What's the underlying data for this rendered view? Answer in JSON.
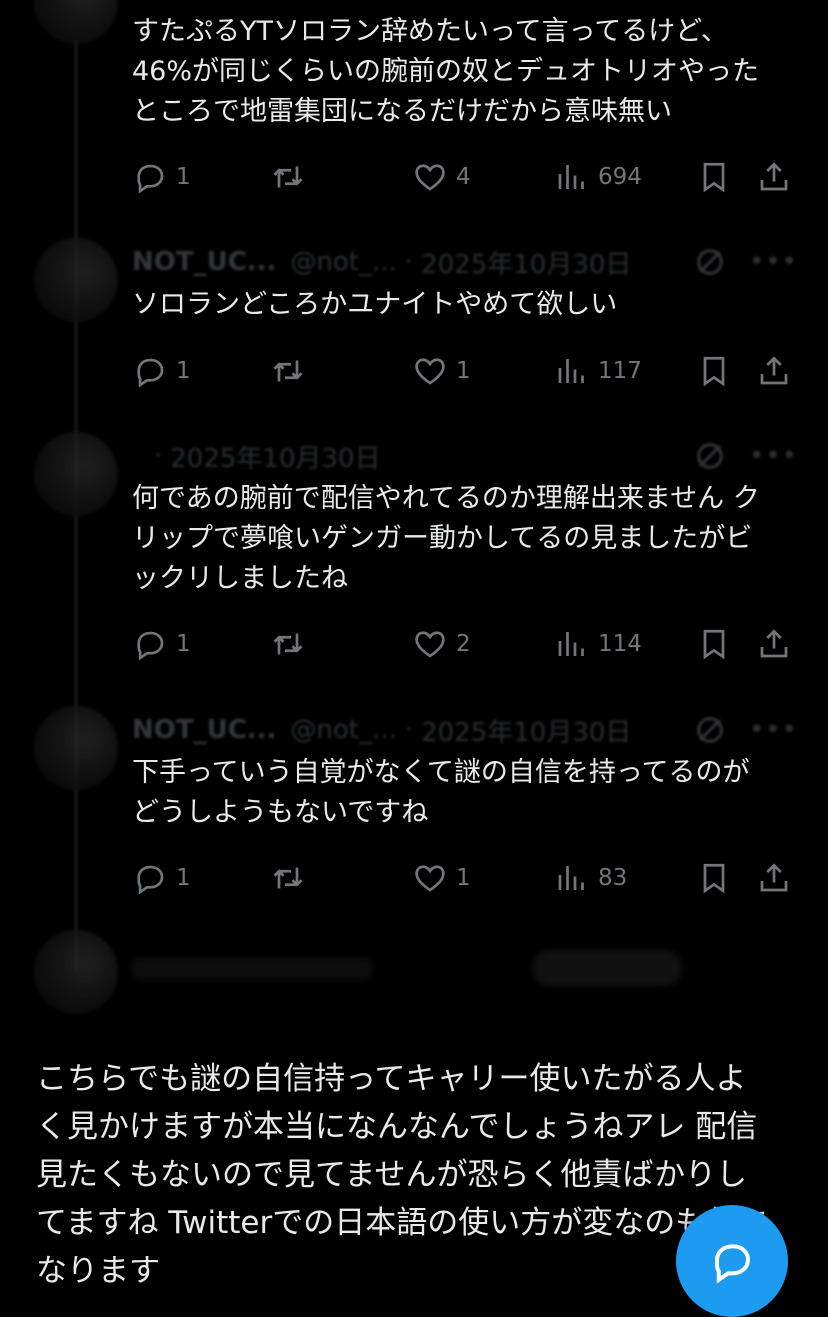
{
  "replies": [
    {
      "display_name": "",
      "handle": "",
      "date": "",
      "text": "すたぷるYTソロラン辞めたいって言ってるけど、\n46%が同じくらいの腕前の奴とデュオトリオやった\nところで地雷集団になるだけだから意味無い",
      "replies": "1",
      "reposts": "",
      "likes": "4",
      "views": "694"
    },
    {
      "display_name": "NOT_UC...",
      "handle": "@not_...",
      "date": "2025年10月30日",
      "text": "ソロランどころかユナイトやめて欲しい",
      "replies": "1",
      "reposts": "",
      "likes": "1",
      "views": "117"
    },
    {
      "display_name": "",
      "handle": "",
      "date": "2025年10月30日",
      "text": "何であの腕前で配信やれてるのか理解出来ません ク\nリップで夢喰いゲンガー動かしてるの見ましたがビ\nックリしましたね",
      "replies": "1",
      "reposts": "",
      "likes": "2",
      "views": "114"
    },
    {
      "display_name": "NOT_UC...",
      "handle": "@not_...",
      "date": "2025年10月30日",
      "text": "下手っていう自覚がなくて謎の自信を持ってるのが\nどうしようもないですね",
      "replies": "1",
      "reposts": "",
      "likes": "1",
      "views": "83"
    }
  ],
  "overlay_caption": "こちらでも謎の自信持ってキャリー使いたがる人よ\nく見かけますが本当になんなんでしょうねアレ 配信\n見たくもないので見てませんが恐らく他責ばかりし\nてますね Twitterでの日本語の使い方が変なのも気に\nなります",
  "icons": {
    "reply": "reply-icon",
    "repost": "repost-icon",
    "like": "heart-icon",
    "views": "views-icon",
    "bookmark": "bookmark-icon",
    "share": "share-icon",
    "grok": "grok-icon",
    "more": "more-icon",
    "compose": "compose-icon"
  },
  "colors": {
    "background": "#000000",
    "text": "#e7e9ea",
    "muted": "#71767b",
    "accent": "#1d9bf0"
  }
}
